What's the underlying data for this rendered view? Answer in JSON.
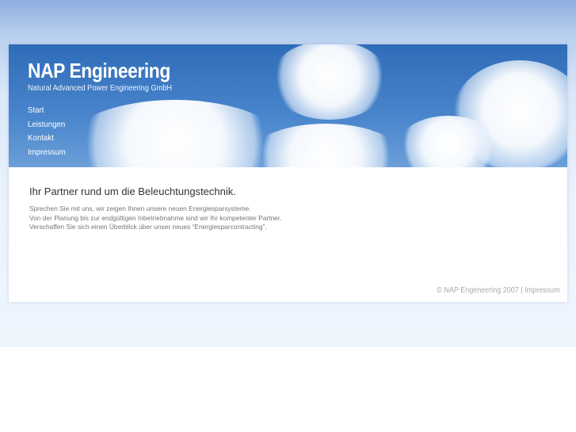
{
  "header": {
    "logo": "NAP Engineering",
    "subtitle": "Natural Advanced Power Engineering GmbH"
  },
  "nav": [
    {
      "label": "Start"
    },
    {
      "label": "Leistungen"
    },
    {
      "label": "Kontakt"
    },
    {
      "label": "Impressum"
    }
  ],
  "main": {
    "heading": "Ihr Partner rund um die Beleuchtungstechnik.",
    "lines": [
      "Sprechen Sie mit uns, wir zeigen Ihnen unsere neuen Energiesparsysteme.",
      "Von der Planung bis zur endgültigen Inbetriebnahme sind wir Ihr kompetenter Partner.",
      "Verschaffen Sie sich einen Überblick über unser neues “Energiesparcontracting”."
    ]
  },
  "footer": {
    "copyright": "© NAP Engeneering 2007 |",
    "impressum": "Impressum"
  }
}
